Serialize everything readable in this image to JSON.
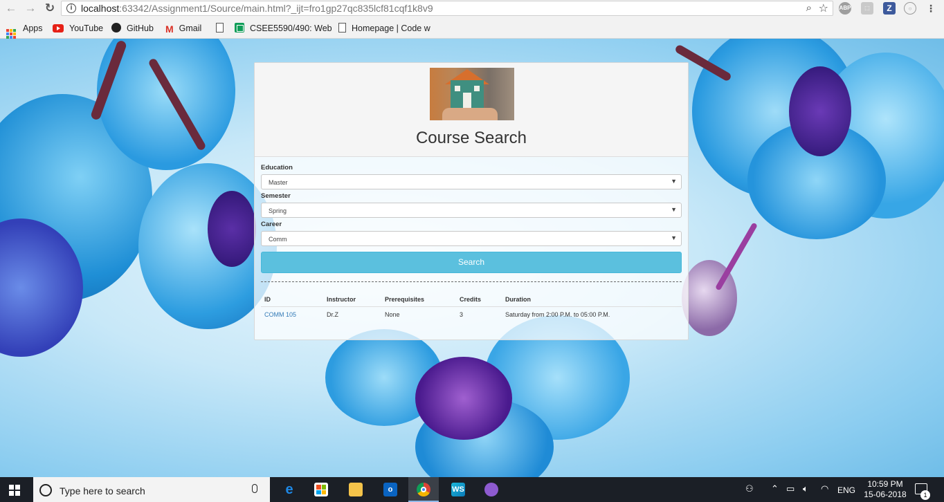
{
  "browser": {
    "url_host": "localhost",
    "url_rest": ":63342/Assignment1/Source/main.html?_ijt=fro1gp27qc835lcf81cqf1k8v9",
    "back_icon": "←",
    "forward_icon": "→",
    "reload_icon": "↻",
    "zoom_icon": "⌕",
    "star_icon": "☆",
    "extensions": [
      "ABP",
      "Z"
    ]
  },
  "bookmarks": {
    "apps": "Apps",
    "youtube": "YouTube",
    "github": "GitHub",
    "gmail": "Gmail",
    "csee": "CSEE5590/490: Web",
    "homepage": "Homepage | Code w"
  },
  "card": {
    "title": "Course Search",
    "education_label": "Education",
    "education_value": "Master",
    "semester_label": "Semester",
    "semester_value": "Spring",
    "career_label": "Career",
    "career_value": "Comm",
    "dropdown_arrow": "▼",
    "search_button": "Search"
  },
  "results": {
    "headers": [
      "ID",
      "Instructor",
      "Prerequisites",
      "Credits",
      "Duration"
    ],
    "rows": [
      {
        "id": "COMM 105",
        "instructor": "Dr.Z",
        "prerequisites": "None",
        "credits": "3",
        "duration": "Saturday from 2:00 P.M. to 05:00 P.M."
      }
    ]
  },
  "taskbar": {
    "search_placeholder": "Type here to search",
    "lang": "ENG",
    "time": "10:59 PM",
    "date": "15-06-2018",
    "notification_count": "1"
  },
  "colors": {
    "search_button": "#5bc0de",
    "link": "#337ab7",
    "taskbar": "#1b1f26"
  }
}
